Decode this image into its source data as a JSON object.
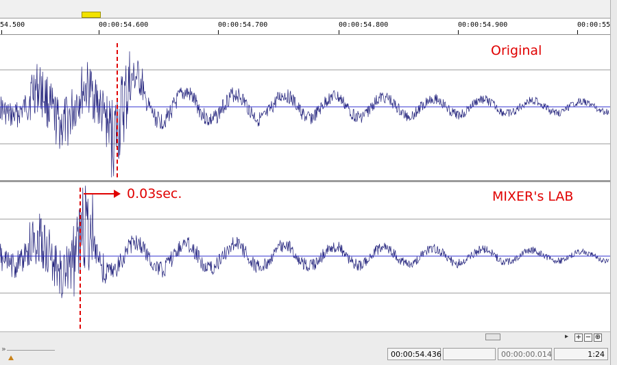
{
  "ruler": {
    "labels": [
      "54.500",
      "00:00:54.600",
      "00:00:54.700",
      "00:00:54.800",
      "00:00:54.900",
      "00:00:55"
    ]
  },
  "tracks": [
    {
      "label": "Original",
      "marker_color": "#e00000"
    },
    {
      "label": "MIXER's LAB",
      "marker_color": "#e00000"
    }
  ],
  "annotation": {
    "offset_text": "0.03sec."
  },
  "status": {
    "cursor_time": "00:00:54.436",
    "selection_length": "00:00:00.014",
    "zoom": "1:24"
  },
  "zoom_buttons": [
    "+",
    "−",
    "⊕"
  ],
  "colors": {
    "waveform": "#1f1f7a",
    "centerline": "#3030d0",
    "annotation": "#e00000"
  }
}
